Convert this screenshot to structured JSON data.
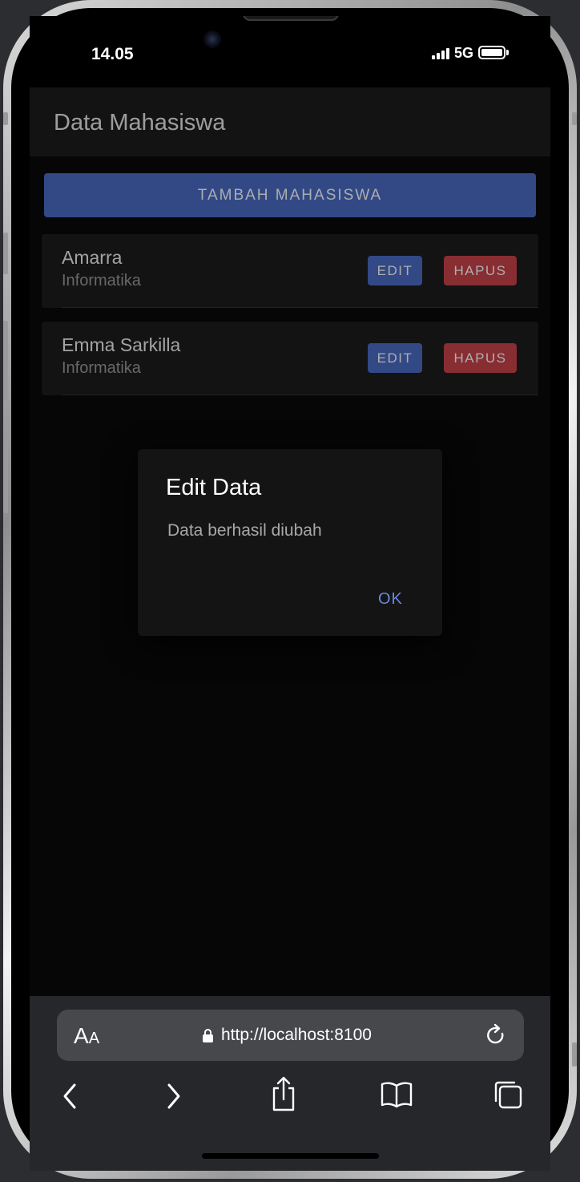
{
  "status_bar": {
    "time": "14.05",
    "network": "5G"
  },
  "app": {
    "title": "Data Mahasiswa",
    "add_button": "TAMBAH MAHASISWA",
    "students": [
      {
        "name": "Amarra",
        "major": "Informatika",
        "edit_label": "EDIT",
        "delete_label": "HAPUS"
      },
      {
        "name": "Emma Sarkilla",
        "major": "Informatika",
        "edit_label": "EDIT",
        "delete_label": "HAPUS"
      }
    ]
  },
  "dialog": {
    "title": "Edit Data",
    "message": "Data berhasil diubah",
    "ok_label": "OK"
  },
  "browser": {
    "text_size_label_big": "A",
    "text_size_label_small": "A",
    "url": "http://localhost:8100"
  },
  "colors": {
    "primary": "#4a6cc6",
    "danger": "#c9434a",
    "dialog_link": "#6688e0"
  },
  "icons": [
    "lock-icon",
    "reload-icon",
    "back-icon",
    "forward-icon",
    "share-icon",
    "bookmarks-icon",
    "tabs-icon"
  ]
}
